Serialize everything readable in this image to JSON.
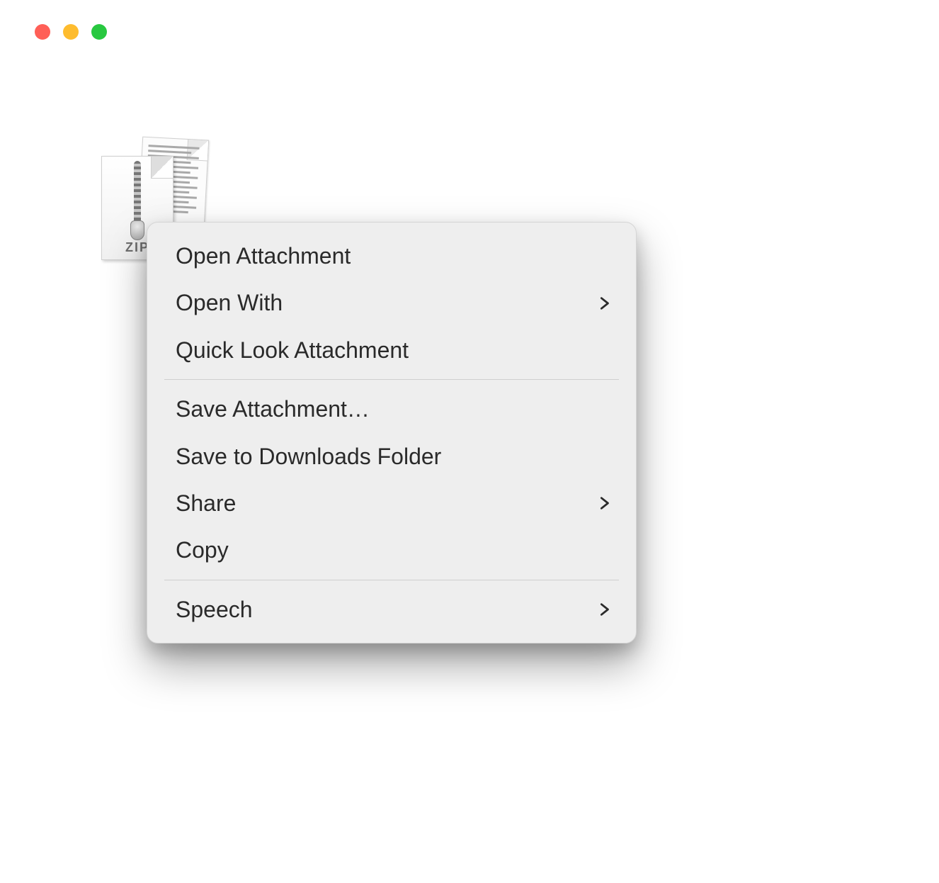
{
  "window": {
    "traffic_lights": {
      "close": "#ff5f57",
      "minimize": "#febc2e",
      "zoom": "#28c840"
    }
  },
  "file": {
    "icon_kind": "zip-archive",
    "zip_label": "ZIP"
  },
  "context_menu": {
    "groups": [
      [
        {
          "key": "open_attachment",
          "label": "Open Attachment",
          "submenu": false
        },
        {
          "key": "open_with",
          "label": "Open With",
          "submenu": true
        },
        {
          "key": "quick_look_attachment",
          "label": "Quick Look Attachment",
          "submenu": false
        }
      ],
      [
        {
          "key": "save_attachment",
          "label": "Save Attachment…",
          "submenu": false
        },
        {
          "key": "save_to_downloads",
          "label": "Save to Downloads Folder",
          "submenu": false
        },
        {
          "key": "share",
          "label": "Share",
          "submenu": true
        },
        {
          "key": "copy",
          "label": "Copy",
          "submenu": false
        }
      ],
      [
        {
          "key": "speech",
          "label": "Speech",
          "submenu": true
        }
      ]
    ]
  }
}
